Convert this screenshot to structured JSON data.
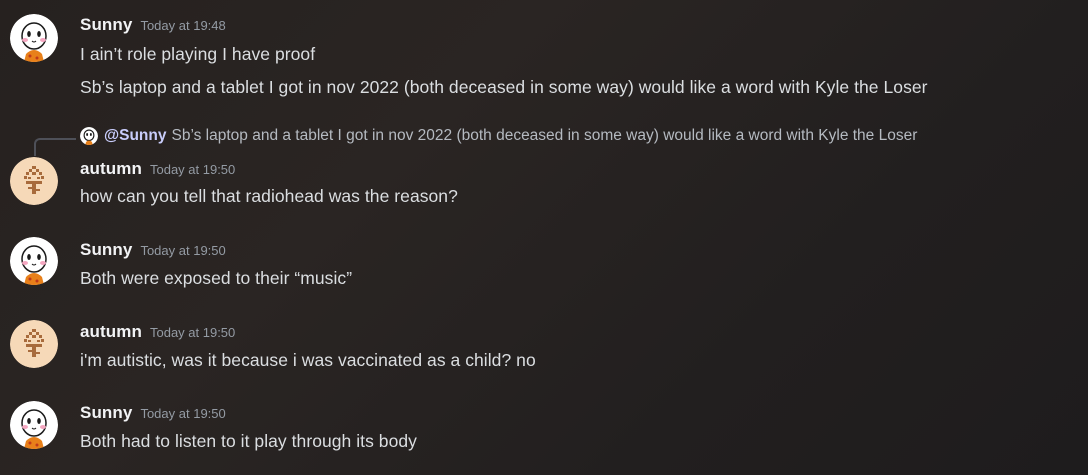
{
  "messages": [
    {
      "author": "Sunny",
      "timestamp": "Today at 19:48",
      "avatar_icon": "sunny-avatar-icon",
      "lines": [
        "I ain’t role playing I have proof",
        "Sb’s laptop and a tablet I got in nov 2022 (both deceased in some way) would like a word with Kyle the Loser"
      ]
    },
    {
      "author": "autumn",
      "timestamp": "Today at 19:50",
      "avatar_icon": "autumn-tree-avatar-icon",
      "reply_to": {
        "mention": "@Sunny",
        "text": "Sb’s laptop and a tablet I got in nov 2022 (both deceased in some way) would like a word with Kyle the Loser"
      },
      "lines": [
        "how can you tell that radiohead was the reason?"
      ]
    },
    {
      "author": "Sunny",
      "timestamp": "Today at 19:50",
      "avatar_icon": "sunny-avatar-icon",
      "lines": [
        "Both were exposed to their “music”"
      ]
    },
    {
      "author": "autumn",
      "timestamp": "Today at 19:50",
      "avatar_icon": "autumn-tree-avatar-icon",
      "lines": [
        "i'm autistic, was it because i was vaccinated as a child? no"
      ]
    },
    {
      "author": "Sunny",
      "timestamp": "Today at 19:50",
      "avatar_icon": "sunny-avatar-icon",
      "lines": [
        "Both had to listen to it play through its body"
      ]
    }
  ],
  "colors": {
    "background": "#27221f",
    "username": "#f2f3f5",
    "timestamp": "#949ba4",
    "message_text": "#dbdee1",
    "mention": "#c9cdfb"
  }
}
